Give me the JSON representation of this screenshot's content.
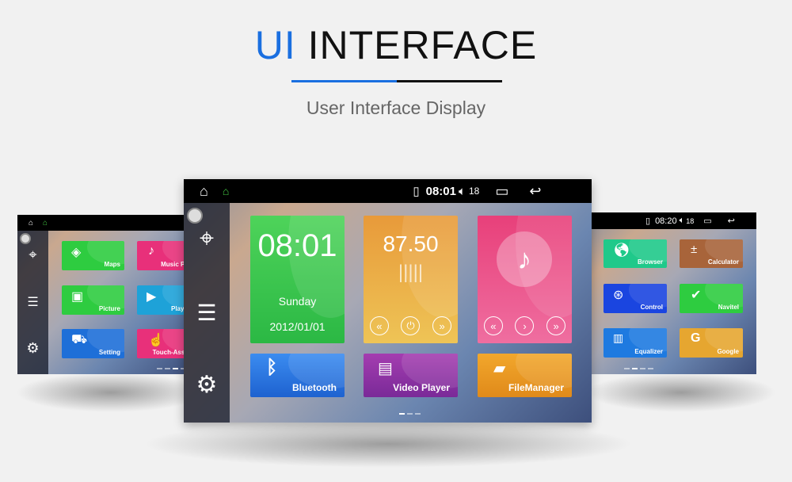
{
  "header": {
    "title_accent": "UI",
    "title_rest": " INTERFACE",
    "subtitle": "User Interface Display",
    "accent_color": "#1a6fe0"
  },
  "left_screen": {
    "apps": [
      {
        "label": "Maps",
        "icon": "maps-icon",
        "color": "#2ecc40"
      },
      {
        "label": "Music Pla",
        "icon": "music-icon",
        "color": "#e8307a"
      },
      {
        "label": "Picture",
        "icon": "picture-icon",
        "color": "#2ecc40"
      },
      {
        "label": "Play S",
        "icon": "play-store-icon",
        "color": "#1ea2d8"
      },
      {
        "label": "Setting",
        "icon": "car-setting-icon",
        "color": "#1e6fd8"
      },
      {
        "label": "Touch-Assis",
        "icon": "touch-icon",
        "color": "#e8307a"
      }
    ]
  },
  "main_screen": {
    "status": {
      "time": "08:01",
      "volume": "18"
    },
    "clock": {
      "time": "08:01",
      "day": "Sunday",
      "date": "2012/01/01"
    },
    "radio": {
      "frequency": "87.50"
    },
    "apps": [
      {
        "label": "Bluetooth",
        "icon": "bluetooth-icon"
      },
      {
        "label": "Video Player",
        "icon": "film-icon"
      },
      {
        "label": "FileManager",
        "icon": "folder-icon"
      }
    ]
  },
  "right_screen": {
    "status": {
      "time": "08:20",
      "volume": "18"
    },
    "apps": [
      {
        "label": "Browser",
        "icon": "globe-icon",
        "color": "#1fc98a"
      },
      {
        "label": "Calculator",
        "icon": "calculator-icon",
        "color": "#a8643a"
      },
      {
        "label": "Control",
        "icon": "steering-wheel-icon",
        "color": "#1a45e0"
      },
      {
        "label": "Navitel",
        "icon": "navitel-icon",
        "color": "#2ecc40"
      },
      {
        "label": "Equalizer",
        "icon": "equalizer-icon",
        "color": "#1e7ae0"
      },
      {
        "label": "Google",
        "icon": "google-icon",
        "color": "#e6a630"
      }
    ]
  }
}
